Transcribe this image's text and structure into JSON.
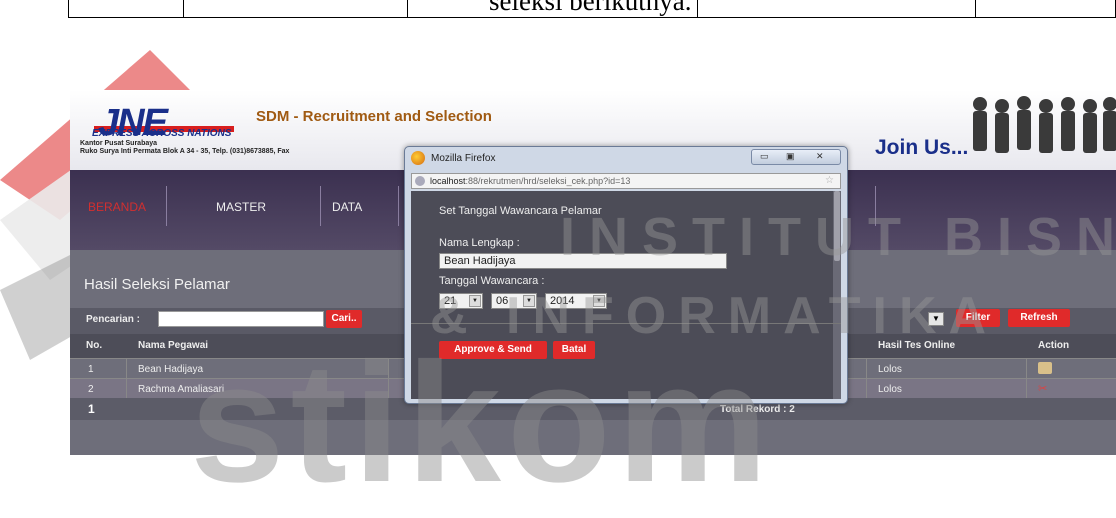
{
  "document": {
    "table_text": "seleksi berikutnya."
  },
  "watermark": {
    "line1": "INSTITUT BISNIS",
    "line2": "& INFORMATIKA",
    "big": "stikom"
  },
  "header": {
    "logo": "JNE",
    "tagline": "EXPRESS ACROSS NATIONS",
    "address_line1": "Kantor Pusat Surabaya",
    "address_line2": "Ruko Surya Inti Permata Blok A 34 - 35, Telp. (031)8673885, Fax",
    "app_title": "SDM - Recruitment and Selection",
    "join": "Join Us..."
  },
  "nav": {
    "items": [
      "BERANDA",
      "MASTER",
      "DATA"
    ]
  },
  "main": {
    "section_title": "Hasil Seleksi Pelamar",
    "search_label": "Pencarian :",
    "search_value": "",
    "search_button": "Cari..",
    "filter_button": "Filter",
    "refresh_button": "Refresh",
    "columns": {
      "no": "No.",
      "name": "Nama Pegawai",
      "result": "Hasil Tes Online",
      "action": "Action"
    },
    "rows": [
      {
        "no": "1",
        "name": "Bean Hadijaya",
        "result": "Lolos"
      },
      {
        "no": "2",
        "name": "Rachma Amaliasari",
        "result": "Lolos"
      }
    ],
    "page": "1",
    "total": "Total Rekord : 2"
  },
  "popup": {
    "window_title": "Mozilla Firefox",
    "url_host": "localhost",
    "url_path": ":88/rekrutmen/hrd/seleksi_cek.php?id=13",
    "form_title": "Set Tanggal Wawancara Pelamar",
    "name_label": "Nama Lengkap :",
    "name_value": "Bean Hadijaya",
    "date_label": "Tanggal Wawancara :",
    "day": "21",
    "month": "06",
    "year": "2014",
    "approve_button": "Approve & Send",
    "cancel_button": "Batal"
  }
}
